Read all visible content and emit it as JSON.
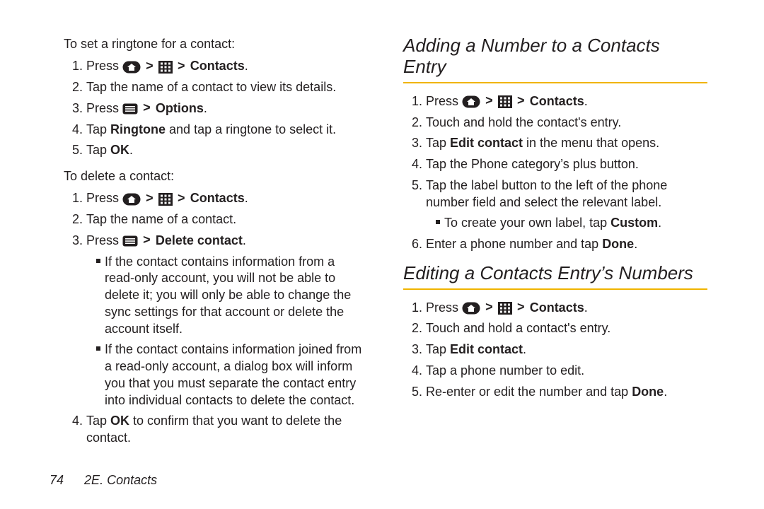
{
  "symbols": {
    "gt": ">"
  },
  "left": {
    "lead1": "To set a ringtone for a contact:",
    "ringtone": {
      "s1_press": "Press ",
      "s1_contacts": "Contacts",
      "s1_period": ".",
      "s2": "Tap the name of a contact to view its details.",
      "s3_press": "Press ",
      "s3_options": "Options",
      "s3_period": ".",
      "s4_a": "Tap ",
      "s4_b": "Ringtone",
      "s4_c": " and tap a ringtone to select it.",
      "s5_a": "Tap ",
      "s5_b": "OK",
      "s5_c": "."
    },
    "lead2": "To delete a contact:",
    "del": {
      "s1_press": "Press ",
      "s1_contacts": "Contacts",
      "s1_period": ".",
      "s2": "Tap the name of a contact.",
      "s3_press": "Press ",
      "s3_delc": "Delete contact",
      "s3_period": ".",
      "n1": "If the contact contains information from a read-only account, you will not be able to delete it; you will only be able to change the sync settings for that account or delete the account itself.",
      "n2": "If the contact contains information joined from a read-only account, a dialog box will inform you that you must separate the contact entry into individual contacts to delete the contact.",
      "s4_a": "Tap ",
      "s4_b": "OK",
      "s4_c": " to confirm that you want to delete the contact."
    }
  },
  "right": {
    "h1": "Adding a Number to a Contacts Entry",
    "add": {
      "s1_press": "Press ",
      "s1_contacts": "Contacts",
      "s1_period": ".",
      "s2": "Touch and hold the contact's entry.",
      "s3_a": "Tap ",
      "s3_b": "Edit contact",
      "s3_c": " in the menu that opens.",
      "s4": "Tap the Phone category’s plus button.",
      "s5": "Tap the label button to the left of the phone number field and select the relevant label.",
      "n1_a": "To create your own label, tap ",
      "n1_b": "Custom",
      "n1_c": ".",
      "s6_a": "Enter a phone number and tap ",
      "s6_b": "Done",
      "s6_c": "."
    },
    "h2": "Editing a Contacts Entry’s Numbers",
    "edit": {
      "s1_press": "Press ",
      "s1_contacts": "Contacts",
      "s1_period": ".",
      "s2": "Touch and hold a contact's entry.",
      "s3_a": "Tap ",
      "s3_b": "Edit contact",
      "s3_c": ".",
      "s4": "Tap a phone number to edit.",
      "s5_a": "Re-enter or edit the number and tap ",
      "s5_b": "Done",
      "s5_c": "."
    }
  },
  "footer": {
    "page": "74",
    "title": "2E. Contacts"
  }
}
